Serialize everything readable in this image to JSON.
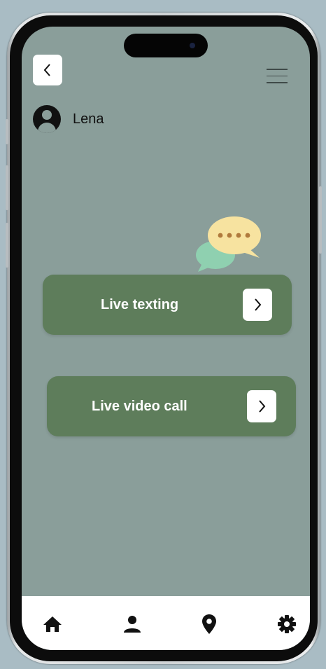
{
  "user": {
    "name": "Lena"
  },
  "options": [
    {
      "label": "Live texting"
    },
    {
      "label": "Live video call"
    }
  ],
  "icons": {
    "back": "chevron-left-icon",
    "menu": "hamburger-menu-icon",
    "avatar": "user-avatar-icon",
    "chat": "chat-bubbles-icon",
    "next": "chevron-right-icon",
    "tabs": [
      "home-icon",
      "person-icon",
      "location-pin-icon",
      "gear-icon"
    ]
  },
  "colors": {
    "screen_background": "#8a9e9a",
    "card_background": "#5e7d5b",
    "chat_bubble_front": "#f7e3a0",
    "chat_bubble_back": "#8fd0b0",
    "chat_dots": "#b07a3c",
    "tab_bar": "#ffffff"
  }
}
